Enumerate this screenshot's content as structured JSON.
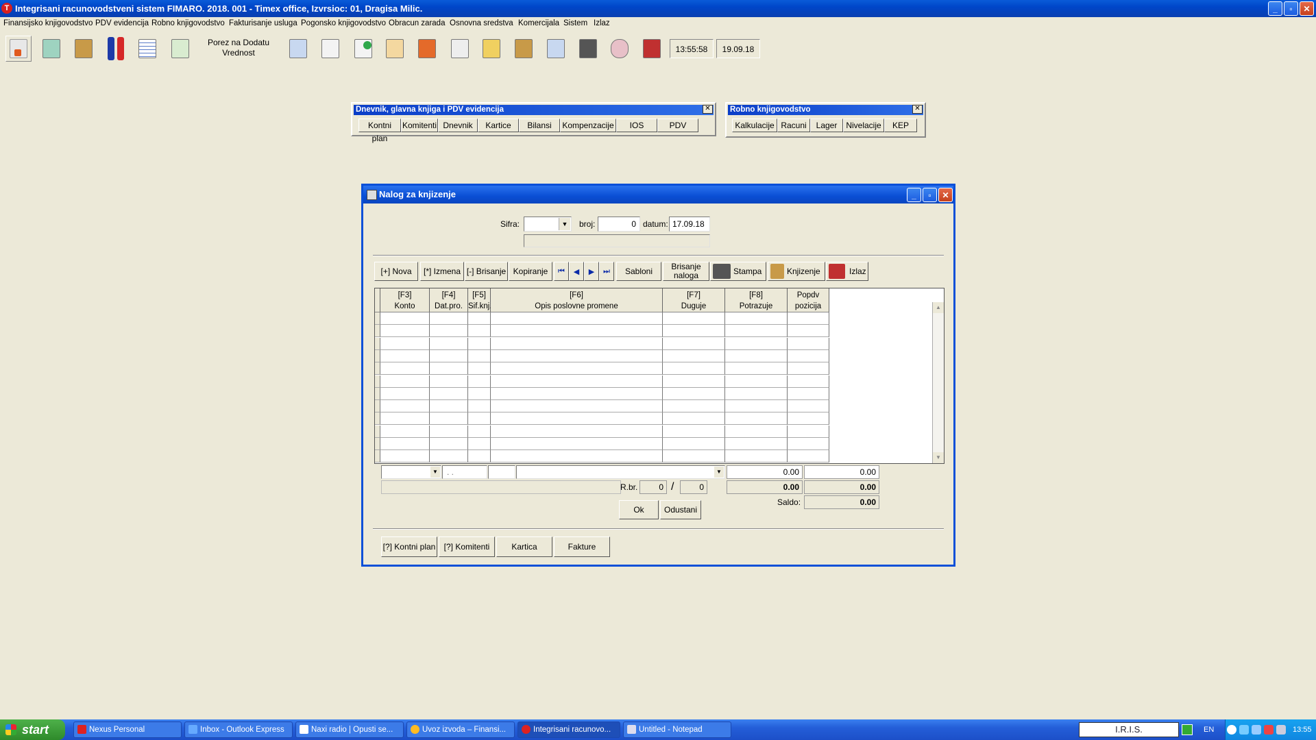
{
  "window": {
    "title": "Integrisani racunovodstveni sistem FIMARO. 2018. 001 - Timex office, Izvrsioc: 01, Dragisa Milic.",
    "app_icon_letter": "T"
  },
  "menu": [
    "Finansijsko knjigovodstvo",
    "PDV evidencija",
    "Robno knjigovodstvo",
    "Fakturisanje usluga",
    "Pogonsko knjigovodstvo",
    "Obracun zarada",
    "Osnovna sredstva",
    "Komercijala",
    "Sistem",
    "Izlaz"
  ],
  "toolbar": {
    "porez_line1": "Porez na Dodatu",
    "porez_line2": "Vrednost",
    "time": "13:55:58",
    "date": "19.09.18"
  },
  "panel_finance": {
    "title": "Dnevnik, glavna knjiga i  PDV evidencija",
    "buttons": [
      "Kontni plan",
      "Komitenti",
      "Dnevnik",
      "Kartice",
      "Bilansi",
      "Kompenzacije",
      "IOS",
      "PDV"
    ]
  },
  "panel_robno": {
    "title": "Robno knjigovodstvo",
    "buttons": [
      "Kalkulacije",
      "Racuni",
      "Lager",
      "Nivelacije",
      "KEP"
    ]
  },
  "dialog": {
    "title": "Nalog za knjizenje",
    "sifra_label": "Sifra:",
    "sifra_value": "",
    "broj_label": "broj:",
    "broj_value": "0",
    "datum_label": "datum:",
    "datum_value": "17.09.18",
    "toolbar": {
      "nova": "[+] Nova",
      "izmena": "[*] Izmena",
      "brisanje": "[-] Brisanje",
      "kopiranje": "Kopiranje",
      "sabloni": "Sabloni",
      "brisanje_naloga_1": "Brisanje",
      "brisanje_naloga_2": "naloga",
      "stampa": "Stampa",
      "knjizenje": "Knjizenje",
      "izlaz": "Izlaz"
    },
    "grid": {
      "keys": [
        "[F3]",
        "[F4]",
        "[F5]",
        "[F6]",
        "[F7]",
        "[F8]",
        "Popdv"
      ],
      "headers": [
        "Konto",
        "Dat.pro.",
        "Sif.knj.",
        "Opis poslovne promene",
        "Duguje",
        "Potrazuje",
        "pozicija"
      ]
    },
    "edit_row": {
      "date_placeholder": " . .",
      "duguje": "0.00",
      "potrazuje": "0.00"
    },
    "totals": {
      "rbr_label": "R.br.",
      "rbr_value": "0",
      "rbr_sep": "/",
      "rbr_total": "0",
      "duguje": "0.00",
      "potrazuje": "0.00",
      "saldo_label": "Saldo:",
      "saldo": "0.00"
    },
    "ok": "Ok",
    "odustani": "Odustani",
    "bottom_buttons": [
      "[?] Kontni plan",
      "[?] Komitenti",
      "Kartica",
      "Fakture"
    ]
  },
  "taskbar": {
    "start": "start",
    "items": [
      "Nexus Personal",
      "Inbox - Outlook Express",
      "Naxi radio | Opusti se...",
      "Uvoz izvoda – Finansi...",
      "Integrisani racunovo...",
      "Untitled - Notepad"
    ],
    "iris": "I.R.I.S.",
    "lang": "EN",
    "time": "13:55"
  },
  "colors": {
    "title_blue": "#0a4ed4",
    "desktop": "#ece9d8",
    "taskbar": "#245ed8"
  }
}
